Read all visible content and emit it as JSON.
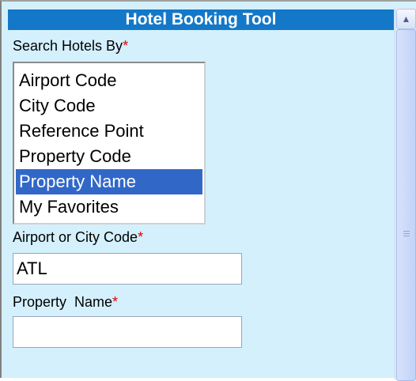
{
  "window": {
    "title": "Hotel Booking Tool"
  },
  "search_by": {
    "label": "Search Hotels By",
    "required_mark": "*",
    "options": [
      "Airport Code",
      "City Code",
      "Reference Point",
      "Property Code",
      "Property Name",
      "My Favorites"
    ],
    "selected": "Property Name"
  },
  "airport_city": {
    "label": "Airport or City Code",
    "required_mark": "*",
    "value": "ATL"
  },
  "property_name": {
    "label": "Property  Name",
    "required_mark": "*",
    "value": ""
  },
  "colors": {
    "title_bar": "#1478c8",
    "panel_bg": "#d4f0fc",
    "selection": "#3168c8",
    "required": "#e00000"
  }
}
